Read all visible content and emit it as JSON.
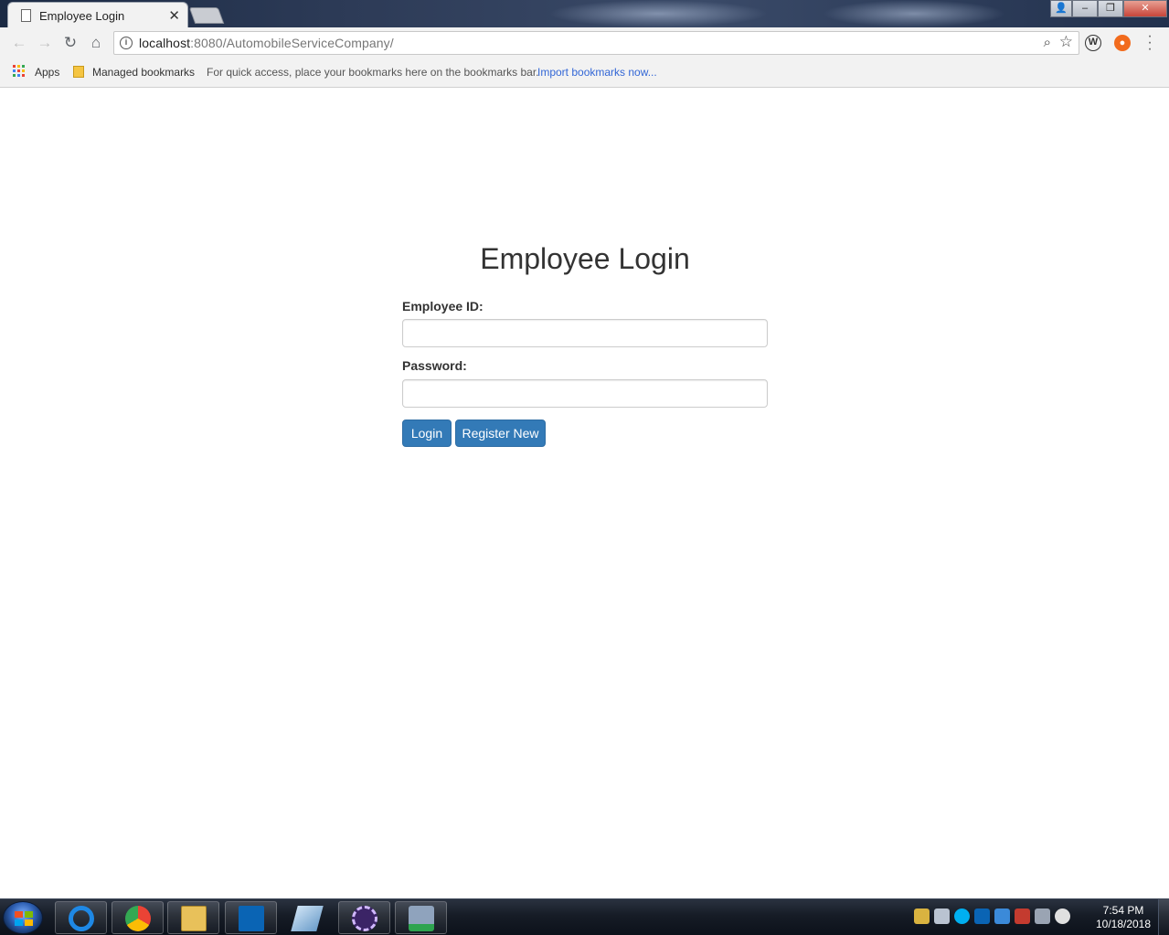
{
  "browser": {
    "tab_title": "Employee Login",
    "tab_close": "✕",
    "url_host": "localhost",
    "url_rest": ":8080/AutomobileServiceCompany/",
    "window_controls": {
      "minimize": "–",
      "restore": "❐",
      "close": "✕"
    }
  },
  "bookmarks": {
    "apps_label": "Apps",
    "managed_label": "Managed bookmarks",
    "hint": "For quick access, place your bookmarks here on the bookmarks bar.",
    "import_link": "Import bookmarks now..."
  },
  "login": {
    "title": "Employee Login",
    "employee_id_label": "Employee ID:",
    "employee_id_value": "",
    "password_label": "Password:",
    "password_value": "",
    "login_button": "Login",
    "register_button": "Register New"
  },
  "taskbar": {
    "time": "7:54 PM",
    "date": "10/18/2018",
    "apps": [
      "internet-explorer",
      "chrome",
      "file-explorer",
      "outlook",
      "notes",
      "java-ee-ide",
      "media-player"
    ]
  },
  "colors": {
    "primary_button": "#337ab7",
    "link": "#3367d6"
  }
}
